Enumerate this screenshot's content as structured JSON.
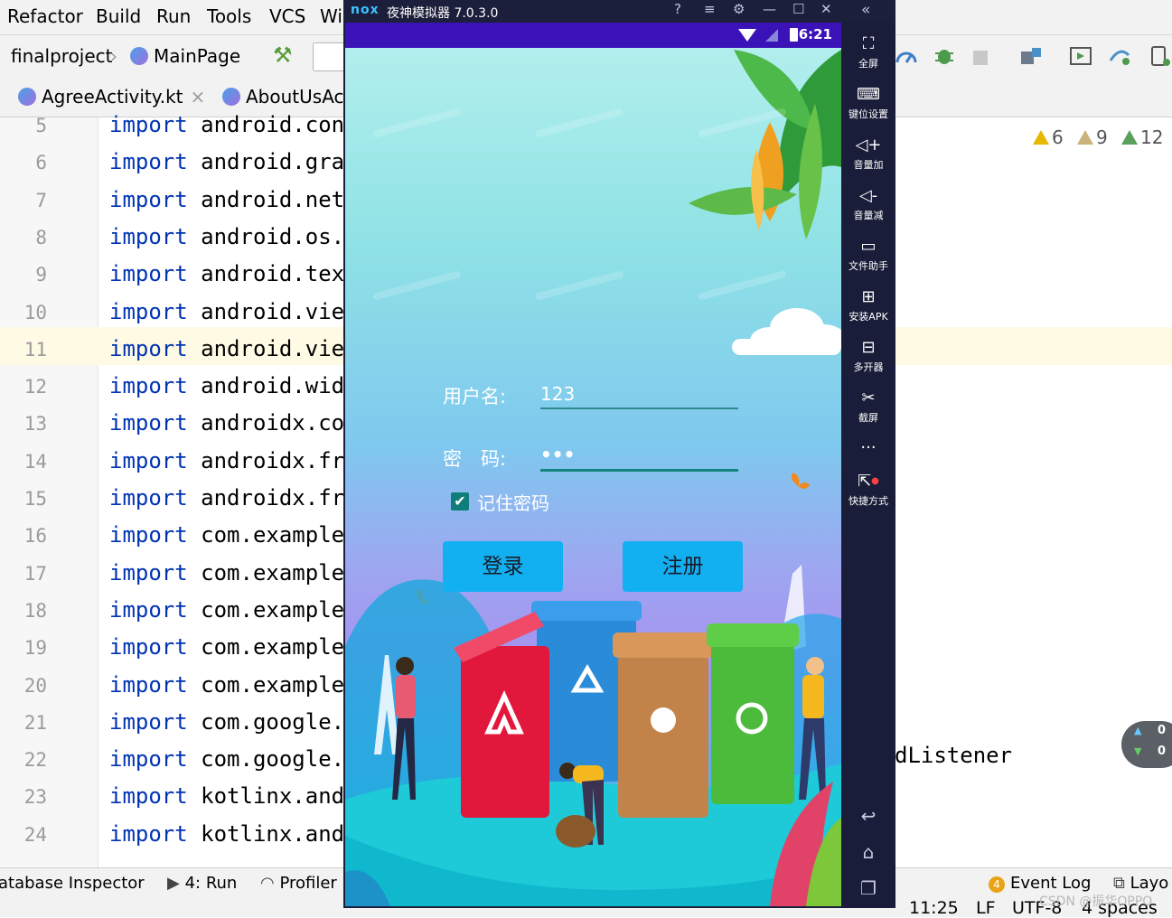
{
  "ide": {
    "menu": [
      "Refactor",
      "Build",
      "Run",
      "Tools",
      "VCS",
      "Wi"
    ],
    "breadcrumbs": [
      "finalproject",
      "MainPage"
    ],
    "tabs": [
      "AgreeActivity.kt",
      "AboutUsAc"
    ],
    "inspections": {
      "warnings": "6",
      "weak_warnings": "9",
      "typos": "12"
    },
    "code_lines": [
      {
        "no": "5",
        "kw": "import",
        "text": "android.cont"
      },
      {
        "no": "6",
        "kw": "import",
        "text": "android.grap"
      },
      {
        "no": "7",
        "kw": "import",
        "text": "android.net."
      },
      {
        "no": "8",
        "kw": "import",
        "text": "android.os.B"
      },
      {
        "no": "9",
        "kw": "import",
        "text": "android.text"
      },
      {
        "no": "10",
        "kw": "import",
        "text": "android.view"
      },
      {
        "no": "11",
        "kw": "import",
        "text": "android.view"
      },
      {
        "no": "12",
        "kw": "import",
        "text": "android.widg"
      },
      {
        "no": "13",
        "kw": "import",
        "text": "androidx.cor"
      },
      {
        "no": "14",
        "kw": "import",
        "text": "androidx.fra"
      },
      {
        "no": "15",
        "kw": "import",
        "text": "androidx.fra"
      },
      {
        "no": "16",
        "kw": "import",
        "text": "com.example."
      },
      {
        "no": "17",
        "kw": "import",
        "text": "com.example."
      },
      {
        "no": "18",
        "kw": "import",
        "text": "com.example."
      },
      {
        "no": "19",
        "kw": "import",
        "text": "com.example."
      },
      {
        "no": "20",
        "kw": "import",
        "text": "com.example."
      },
      {
        "no": "21",
        "kw": "import",
        "text": "com.google.a"
      },
      {
        "no": "22",
        "kw": "import",
        "text": "com.google.a"
      },
      {
        "no": "23",
        "kw": "import",
        "text": "kotlinx.andr"
      },
      {
        "no": "24",
        "kw": "import",
        "text": "kotlinx.andr"
      }
    ],
    "code_right_fragment": "dListener",
    "bottom_tools": [
      "atabase Inspector",
      "4: Run",
      "Profiler"
    ],
    "event_log": {
      "count": "4",
      "label": "Event Log"
    },
    "layout_label": "Layo",
    "status": {
      "position": "11:25",
      "line_sep": "LF",
      "encoding": "UTF-8",
      "indent": "4 spaces"
    },
    "net_widget": [
      "0",
      "0"
    ]
  },
  "nox": {
    "logo": "nox",
    "title": "夜神模拟器 7.0.3.0",
    "status_time": "6:21",
    "sidebar": [
      {
        "icon": "fullscreen-icon",
        "label": "全屏"
      },
      {
        "icon": "keyboard-icon",
        "label": "键位设置"
      },
      {
        "icon": "volume-up-icon",
        "label": "音量加"
      },
      {
        "icon": "volume-down-icon",
        "label": "音量减"
      },
      {
        "icon": "file-assistant-icon",
        "label": "文件助手"
      },
      {
        "icon": "install-apk-icon",
        "label": "安装APK"
      },
      {
        "icon": "multi-instance-icon",
        "label": "多开器"
      },
      {
        "icon": "screenshot-icon",
        "label": "截屏"
      },
      {
        "icon": "more-icon",
        "label": "···"
      },
      {
        "icon": "shortcut-icon",
        "label": "快捷方式"
      }
    ]
  },
  "login": {
    "username_label": "用户名:",
    "username_value": "123",
    "password_label": "密　码:",
    "password_value": "•••",
    "remember_label": "记住密码",
    "remember_checked": true,
    "login_button": "登录",
    "register_button": "注册"
  },
  "watermark": "CSDN @振华OPPO"
}
